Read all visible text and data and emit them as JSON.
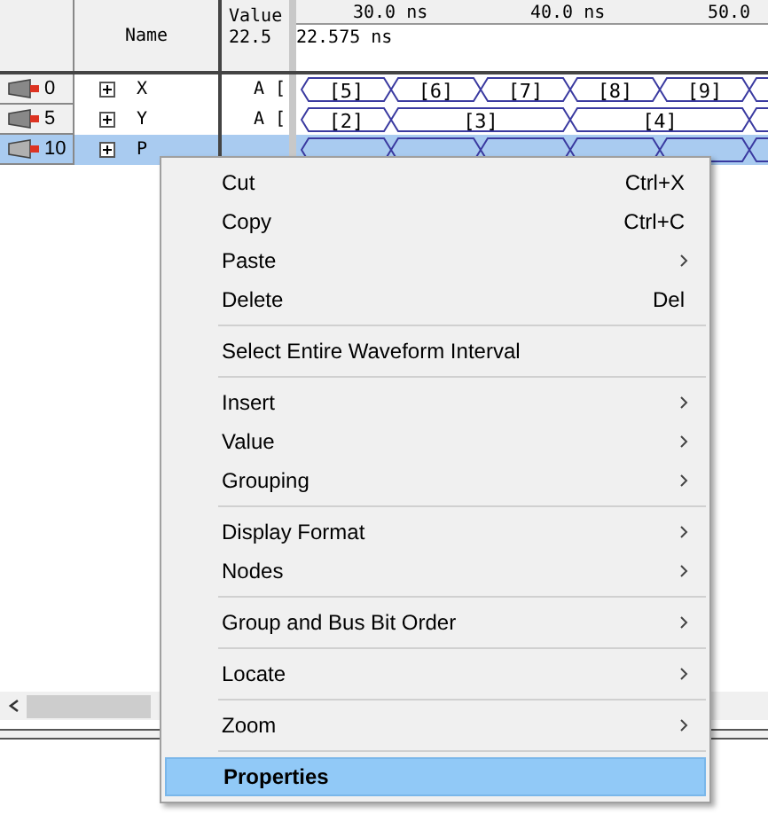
{
  "header": {
    "name_label": "Name",
    "value_label": "Value",
    "value_time": "22.5",
    "cursor_time": "22.575 ns",
    "ruler": [
      "30.0 ns",
      "40.0 ns",
      "50.0"
    ]
  },
  "signals": [
    {
      "index": "0",
      "name": "X",
      "value": "A [",
      "selected": false,
      "segments": [
        "[5]",
        "[6]",
        "[7]",
        "[8]",
        "[9]"
      ]
    },
    {
      "index": "5",
      "name": "Y",
      "value": "A [",
      "selected": false,
      "segments": [
        "[2]",
        "[3]",
        "[4]"
      ]
    },
    {
      "index": "10",
      "name": "P",
      "selected": true
    }
  ],
  "context_menu": [
    {
      "kind": "item",
      "label": "Cut",
      "shortcut": "Ctrl+X",
      "submenu": false,
      "default": false,
      "selected": false
    },
    {
      "kind": "item",
      "label": "Copy",
      "shortcut": "Ctrl+C",
      "submenu": false,
      "default": false,
      "selected": false
    },
    {
      "kind": "item",
      "label": "Paste",
      "submenu": true,
      "default": false,
      "selected": false
    },
    {
      "kind": "item",
      "label": "Delete",
      "shortcut": "Del",
      "submenu": false,
      "default": false,
      "selected": false
    },
    {
      "kind": "separator"
    },
    {
      "kind": "item",
      "label": "Select Entire Waveform Interval",
      "submenu": false,
      "default": false,
      "selected": false
    },
    {
      "kind": "separator"
    },
    {
      "kind": "item",
      "label": "Insert",
      "submenu": true,
      "default": false,
      "selected": false
    },
    {
      "kind": "item",
      "label": "Value",
      "submenu": true,
      "default": false,
      "selected": false
    },
    {
      "kind": "item",
      "label": "Grouping",
      "submenu": true,
      "default": false,
      "selected": false
    },
    {
      "kind": "separator"
    },
    {
      "kind": "item",
      "label": "Display Format",
      "submenu": true,
      "default": false,
      "selected": false
    },
    {
      "kind": "item",
      "label": "Nodes",
      "submenu": true,
      "default": false,
      "selected": false
    },
    {
      "kind": "separator"
    },
    {
      "kind": "item",
      "label": "Group and Bus Bit Order",
      "submenu": true,
      "default": false,
      "selected": false
    },
    {
      "kind": "separator"
    },
    {
      "kind": "item",
      "label": "Locate",
      "submenu": true,
      "default": false,
      "selected": false
    },
    {
      "kind": "separator"
    },
    {
      "kind": "item",
      "label": "Zoom",
      "submenu": true,
      "default": false,
      "selected": false
    },
    {
      "kind": "separator"
    },
    {
      "kind": "item",
      "label": "Properties",
      "submenu": false,
      "default": true,
      "selected": true
    }
  ]
}
